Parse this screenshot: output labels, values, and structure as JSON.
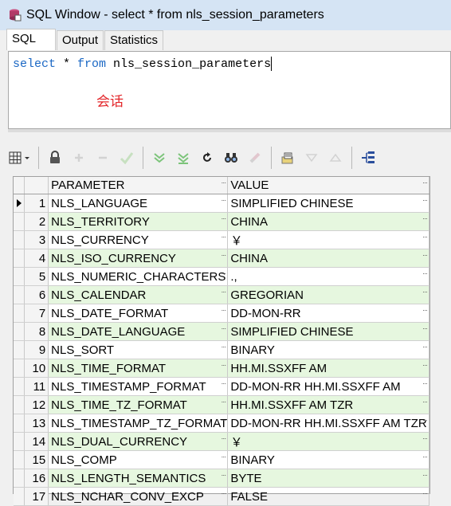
{
  "window": {
    "title": "SQL Window - select * from nls_session_parameters"
  },
  "tabs": [
    {
      "label": "SQL",
      "active": true
    },
    {
      "label": "Output",
      "active": false
    },
    {
      "label": "Statistics",
      "active": false
    }
  ],
  "editor": {
    "kw_select": "select",
    "star": " * ",
    "kw_from": "from",
    "rest": " nls_session_parameters",
    "note": "会话"
  },
  "toolbar": {
    "icons": [
      "grid-menu-icon",
      "lock-icon",
      "add-record-icon",
      "delete-record-icon",
      "post-changes-icon",
      "fetch-next-icon",
      "fetch-last-icon",
      "refresh-icon",
      "find-icon",
      "clear-icon",
      "export-icon",
      "previous-icon",
      "next-icon",
      "tree-icon"
    ]
  },
  "grid": {
    "columns": [
      "PARAMETER",
      "VALUE"
    ],
    "rows": [
      {
        "num": "1",
        "parameter": "NLS_LANGUAGE",
        "value": "SIMPLIFIED CHINESE"
      },
      {
        "num": "2",
        "parameter": "NLS_TERRITORY",
        "value": "CHINA"
      },
      {
        "num": "3",
        "parameter": "NLS_CURRENCY",
        "value": "￥"
      },
      {
        "num": "4",
        "parameter": "NLS_ISO_CURRENCY",
        "value": "CHINA"
      },
      {
        "num": "5",
        "parameter": "NLS_NUMERIC_CHARACTERS",
        "value": ".,"
      },
      {
        "num": "6",
        "parameter": "NLS_CALENDAR",
        "value": "GREGORIAN"
      },
      {
        "num": "7",
        "parameter": "NLS_DATE_FORMAT",
        "value": "DD-MON-RR"
      },
      {
        "num": "8",
        "parameter": "NLS_DATE_LANGUAGE",
        "value": "SIMPLIFIED CHINESE"
      },
      {
        "num": "9",
        "parameter": "NLS_SORT",
        "value": "BINARY"
      },
      {
        "num": "10",
        "parameter": "NLS_TIME_FORMAT",
        "value": "HH.MI.SSXFF AM"
      },
      {
        "num": "11",
        "parameter": "NLS_TIMESTAMP_FORMAT",
        "value": "DD-MON-RR HH.MI.SSXFF AM"
      },
      {
        "num": "12",
        "parameter": "NLS_TIME_TZ_FORMAT",
        "value": "HH.MI.SSXFF AM TZR"
      },
      {
        "num": "13",
        "parameter": "NLS_TIMESTAMP_TZ_FORMAT",
        "value": "DD-MON-RR HH.MI.SSXFF AM TZR"
      },
      {
        "num": "14",
        "parameter": "NLS_DUAL_CURRENCY",
        "value": "￥"
      },
      {
        "num": "15",
        "parameter": "NLS_COMP",
        "value": "BINARY"
      },
      {
        "num": "16",
        "parameter": "NLS_LENGTH_SEMANTICS",
        "value": "BYTE"
      },
      {
        "num": "17",
        "parameter": "NLS_NCHAR_CONV_EXCP",
        "value": "FALSE"
      }
    ]
  },
  "colors": {
    "keyword": "#1a67c4",
    "note": "#e3272b",
    "alt_row": "#e6f7df",
    "titlebar": "#d5e4f4"
  }
}
